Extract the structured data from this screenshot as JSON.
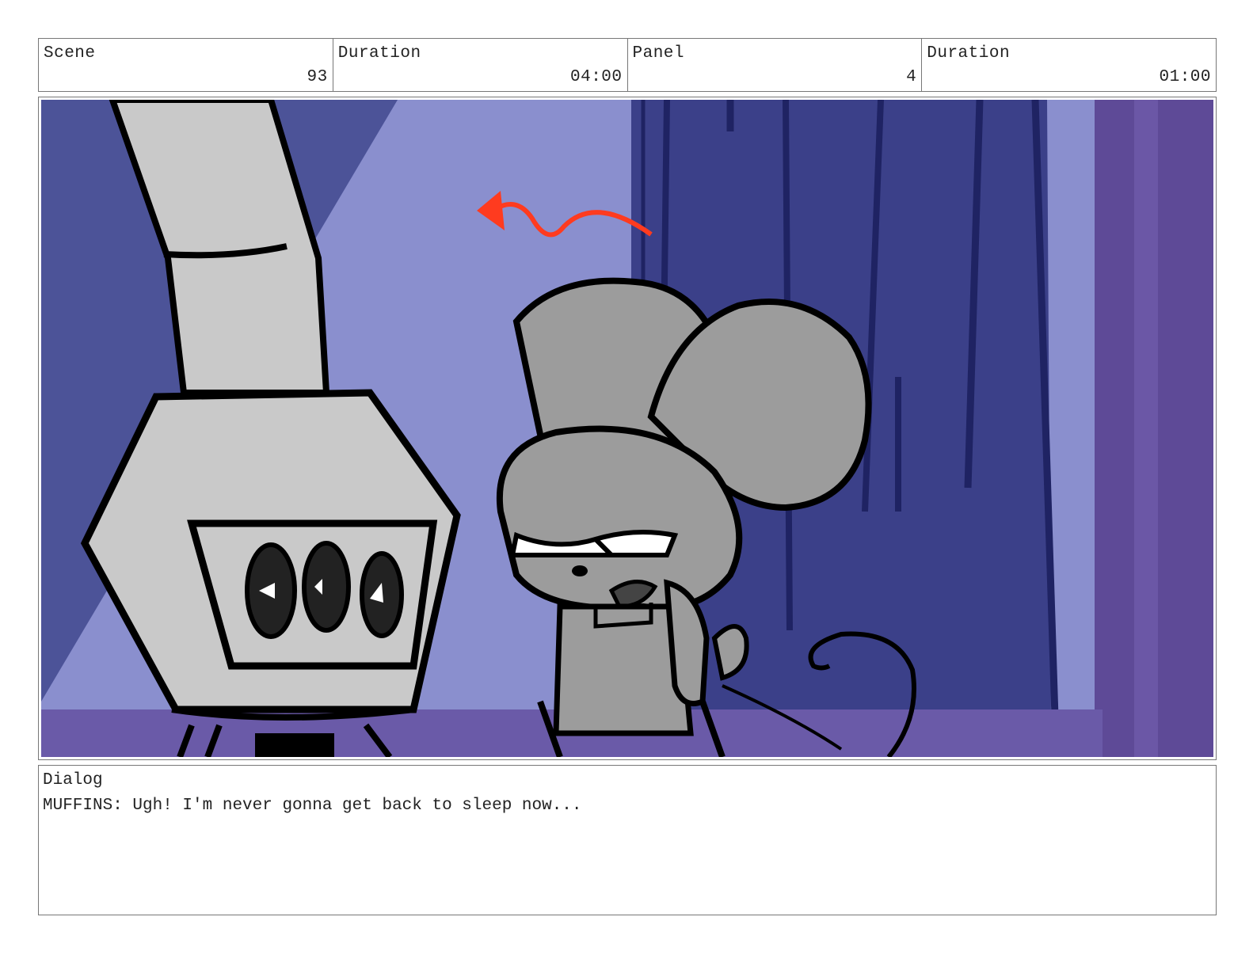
{
  "header": {
    "scene_label": "Scene",
    "scene_value": "93",
    "scene_duration_label": "Duration",
    "scene_duration_value": "04:00",
    "panel_label": "Panel",
    "panel_value": "4",
    "panel_duration_label": "Duration",
    "panel_duration_value": "01:00"
  },
  "panel": {
    "background_color": "#8a8fce",
    "curtain_color": "#3b4089",
    "frame_color": "#5e4a97",
    "arrow_color": "#ff3b1f",
    "icons": [
      "wood-stove-icon",
      "mouse-character-icon",
      "motion-arrow-icon",
      "curtain-icon"
    ]
  },
  "dialog": {
    "label": "Dialog",
    "text": "MUFFINS: Ugh! I'm never gonna get back to sleep now..."
  }
}
